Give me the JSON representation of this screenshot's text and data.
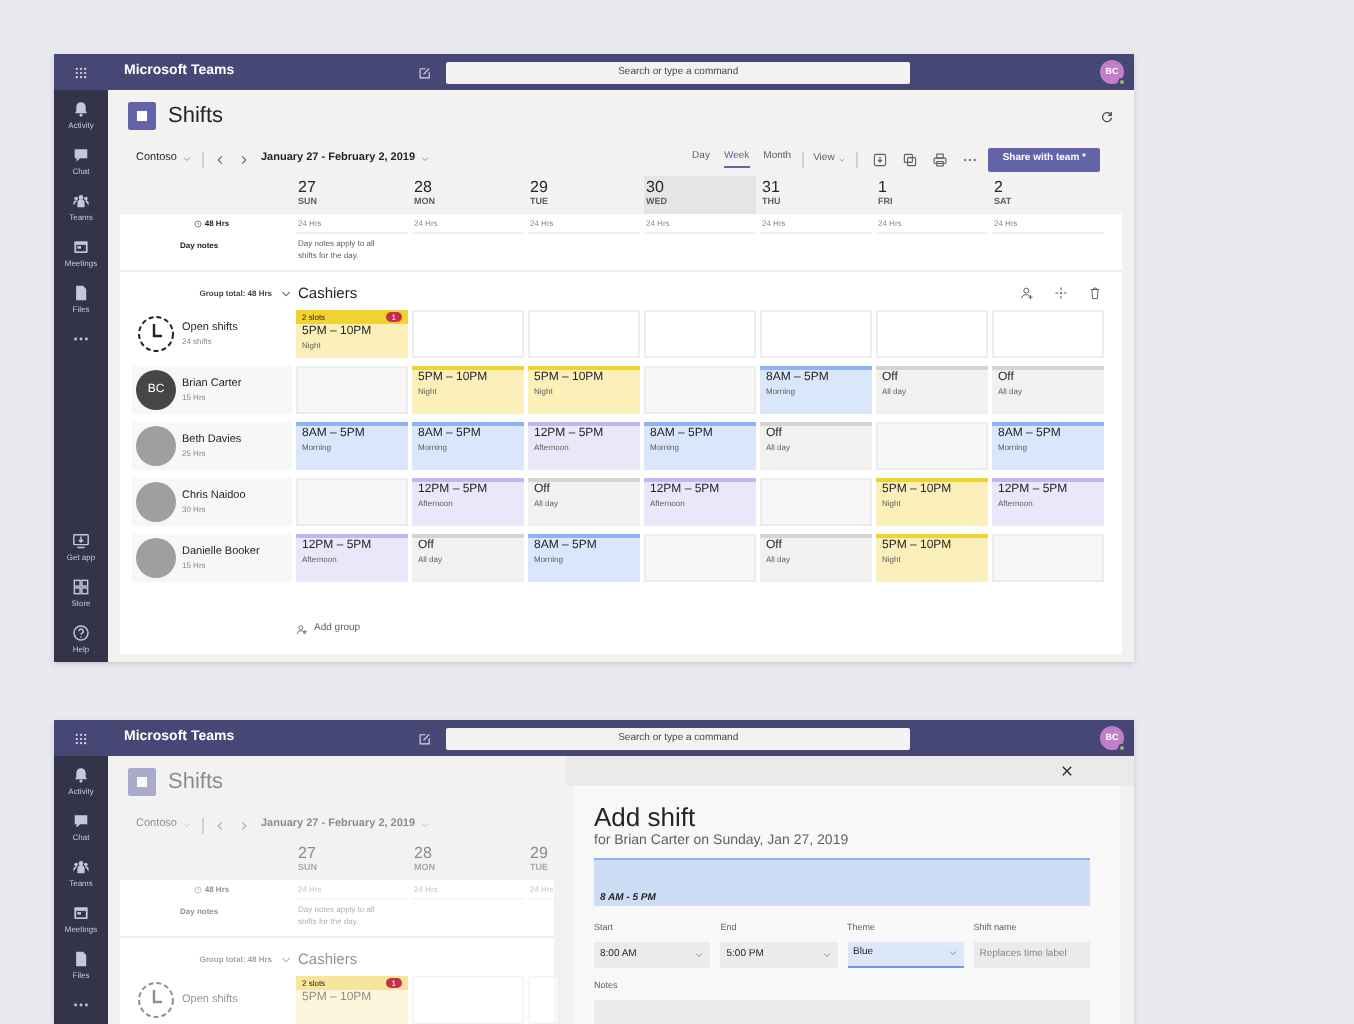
{
  "windows": [
    {
      "title_bar": {
        "title": "Microsoft Teams",
        "search": {
          "placeholder": "Search or type a command"
        },
        "avatar": "BC"
      },
      "rail": {
        "top": [
          {
            "kind": "bell",
            "label": "Activity"
          },
          {
            "kind": "chat",
            "label": "Chat"
          },
          {
            "kind": "teams",
            "label": "Teams"
          },
          {
            "kind": "calendar",
            "label": "Meetings"
          },
          {
            "kind": "file",
            "label": "Files"
          },
          {
            "kind": "more"
          }
        ],
        "bottom": [
          {
            "kind": "getapp",
            "label": "Get app"
          },
          {
            "kind": "store",
            "label": "Store"
          },
          {
            "kind": "help",
            "label": "Help"
          }
        ]
      },
      "header": {
        "title": "Shifts"
      },
      "toolbar": {
        "team": "Contoso",
        "date_range": "January 27 - February 2, 2019",
        "views": [
          {
            "label": "Day",
            "selected": false
          },
          {
            "label": "Week",
            "selected": true
          },
          {
            "label": "Month",
            "selected": false
          }
        ],
        "view_menu": "View",
        "share_button": "Share with team *"
      },
      "schedule": {
        "total_hours": "48 Hrs",
        "days": [
          {
            "date": "27",
            "weekday": "SUN",
            "hours": "24 Hrs",
            "selected": false
          },
          {
            "date": "28",
            "weekday": "MON",
            "hours": "24 Hrs",
            "selected": false
          },
          {
            "date": "29",
            "weekday": "TUE",
            "hours": "24 Hrs",
            "selected": false
          },
          {
            "date": "30",
            "weekday": "WED",
            "hours": "24 Hrs",
            "selected": true
          },
          {
            "date": "31",
            "weekday": "THU",
            "hours": "24 Hrs",
            "selected": false
          },
          {
            "date": "1",
            "weekday": "FRI",
            "hours": "24 Hrs",
            "selected": false
          },
          {
            "date": "2",
            "weekday": "SAT",
            "hours": "24 Hrs",
            "selected": false
          }
        ],
        "day_notes_label": "Day notes",
        "day_notes": "Day notes apply to all shifts for the day.",
        "group_total": "Group total: 48 Hrs",
        "group": "Cashiers",
        "open_shifts": {
          "name": "Open shifts",
          "count": "24 shifts",
          "cells": [
            {
              "kind": "shift",
              "slots": "2 slots",
              "badge": "1",
              "time": "5PM – 10PM",
              "label": "Night",
              "color": "#f2d230"
            },
            {
              "kind": "empty"
            },
            {
              "kind": "empty"
            },
            {
              "kind": "empty"
            },
            {
              "kind": "empty"
            },
            {
              "kind": "empty"
            },
            {
              "kind": "empty"
            }
          ]
        },
        "members": [
          {
            "name": "Brian Carter",
            "hours": "15 Hrs",
            "avatar": {
              "kind": "initials",
              "text": "BC"
            },
            "cells": [
              {
                "kind": "empty"
              },
              {
                "kind": "shift",
                "time": "5PM – 10PM",
                "label": "Night",
                "color": "#f2d230"
              },
              {
                "kind": "shift",
                "time": "5PM – 10PM",
                "label": "Night",
                "color": "#f2d230"
              },
              {
                "kind": "empty"
              },
              {
                "kind": "shift",
                "time": "8AM – 5PM",
                "label": "Morning",
                "color": "#8fb4f3"
              },
              {
                "kind": "shift",
                "time": "Off",
                "label": "All day",
                "color": "#d6d4d2"
              },
              {
                "kind": "shift",
                "time": "Off",
                "label": "All day",
                "color": "#d6d4d2"
              }
            ]
          },
          {
            "name": "Beth Davies",
            "hours": "25 Hrs",
            "avatar": {
              "kind": "photo"
            },
            "cells": [
              {
                "kind": "shift",
                "time": "8AM – 5PM",
                "label": "Morning",
                "color": "#8fb4f3"
              },
              {
                "kind": "shift",
                "time": "8AM – 5PM",
                "label": "Morning",
                "color": "#8fb4f3"
              },
              {
                "kind": "shift",
                "time": "12PM – 5PM",
                "label": "Afternoon",
                "color": "#c1b6ef"
              },
              {
                "kind": "shift",
                "time": "8AM – 5PM",
                "label": "Morning",
                "color": "#8fb4f3"
              },
              {
                "kind": "shift",
                "time": "Off",
                "label": "All day",
                "color": "#d6d4d2"
              },
              {
                "kind": "empty"
              },
              {
                "kind": "shift",
                "time": "8AM – 5PM",
                "label": "Morning",
                "color": "#8fb4f3"
              }
            ]
          },
          {
            "name": "Chris Naidoo",
            "hours": "30 Hrs",
            "avatar": {
              "kind": "photo"
            },
            "cells": [
              {
                "kind": "empty"
              },
              {
                "kind": "shift",
                "time": "12PM – 5PM",
                "label": "Afternoon",
                "color": "#c1b6ef"
              },
              {
                "kind": "shift",
                "time": "Off",
                "label": "All day",
                "color": "#d6d4d2"
              },
              {
                "kind": "shift",
                "time": "12PM – 5PM",
                "label": "Afternoon",
                "color": "#c1b6ef"
              },
              {
                "kind": "empty"
              },
              {
                "kind": "shift",
                "time": "5PM – 10PM",
                "label": "Night",
                "color": "#f2d230"
              },
              {
                "kind": "shift",
                "time": "12PM – 5PM",
                "label": "Afternoon",
                "color": "#c1b6ef"
              }
            ]
          },
          {
            "name": "Danielle Booker",
            "hours": "15 Hrs",
            "avatar": {
              "kind": "photo"
            },
            "cells": [
              {
                "kind": "shift",
                "time": "12PM – 5PM",
                "label": "Afternoon",
                "color": "#c1b6ef"
              },
              {
                "kind": "shift",
                "time": "Off",
                "label": "All day",
                "color": "#d6d4d2"
              },
              {
                "kind": "shift",
                "time": "8AM – 5PM",
                "label": "Morning",
                "color": "#8fb4f3"
              },
              {
                "kind": "empty"
              },
              {
                "kind": "shift",
                "time": "Off",
                "label": "All day",
                "color": "#d6d4d2"
              },
              {
                "kind": "shift",
                "time": "5PM – 10PM",
                "label": "Night",
                "color": "#f2d230"
              },
              {
                "kind": "empty"
              }
            ]
          }
        ],
        "add_group": "Add group"
      }
    },
    {
      "title_bar": {
        "title": "Microsoft Teams",
        "search": {
          "placeholder": "Search or type a command"
        },
        "avatar": "BC"
      },
      "rail": {
        "top": [
          {
            "kind": "bell",
            "label": "Activity"
          },
          {
            "kind": "chat",
            "label": "Chat"
          },
          {
            "kind": "teams",
            "label": "Teams"
          },
          {
            "kind": "calendar",
            "label": "Meetings"
          },
          {
            "kind": "file",
            "label": "Files"
          },
          {
            "kind": "more"
          }
        ]
      },
      "header": {
        "title": "Shifts"
      },
      "toolbar": {
        "team": "Contoso",
        "date_range": "January 27 - February 2, 2019"
      },
      "schedule": {
        "total_hours": "48 Hrs",
        "days": [
          {
            "date": "27",
            "weekday": "SUN",
            "hours": "24 Hrs"
          },
          {
            "date": "28",
            "weekday": "MON",
            "hours": "24 Hrs"
          },
          {
            "date": "29",
            "weekday": "TUE",
            "hours": "24 Hrs"
          }
        ],
        "day_notes_label": "Day notes",
        "day_notes": "Day notes apply to all shifts for the day.",
        "group_total": "Group total: 48 Hrs",
        "group": "Cashiers",
        "open_shifts": {
          "name": "Open shifts",
          "cells": [
            {
              "kind": "shift",
              "slots": "2 slots",
              "badge": "1",
              "time": "5PM – 10PM",
              "color": "#f6e59a"
            },
            {
              "kind": "empty"
            },
            {
              "kind": "empty"
            }
          ]
        }
      },
      "panel": {
        "title": "Add shift",
        "subtitle": "for Brian Carter on Sunday, Jan 27, 2019",
        "preview": {
          "time": "8 AM - 5 PM",
          "color": "#8fb4f3"
        },
        "fields": [
          {
            "kind": "select",
            "label": "Start",
            "value": "8:00 AM",
            "focused": false
          },
          {
            "kind": "select",
            "label": "End",
            "value": "5:00 PM",
            "focused": false
          },
          {
            "kind": "select",
            "label": "Theme",
            "value": "Blue",
            "focused": true
          },
          {
            "kind": "text",
            "label": "Shift name",
            "placeholder": "Replaces time label",
            "focused": false
          }
        ],
        "notes_label": "Notes"
      }
    }
  ]
}
